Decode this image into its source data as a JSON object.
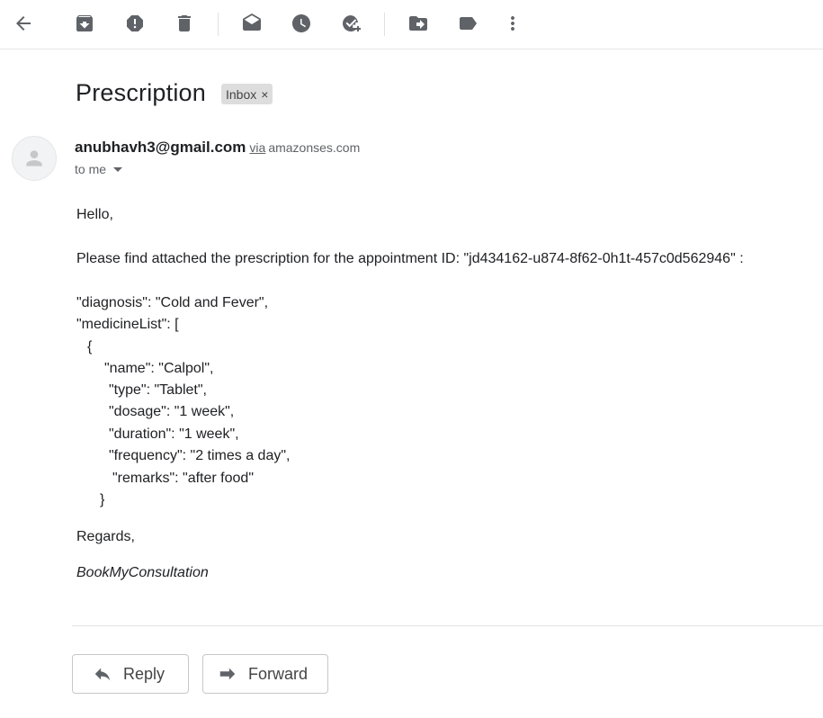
{
  "toolbar": {
    "icons": [
      "back-arrow-icon",
      "archive-icon",
      "report-spam-icon",
      "delete-icon",
      "mark-unread-icon",
      "snooze-icon",
      "add-to-tasks-icon",
      "move-to-icon",
      "label-icon",
      "more-vert-icon"
    ],
    "icon_color": "#5f6368"
  },
  "email": {
    "subject": "Prescription",
    "label": "Inbox",
    "label_remove": "×",
    "sender_name": "anubhavh3@gmail.com",
    "via": "via",
    "sender_domain": "amazonses.com",
    "recipient": "to me"
  },
  "body": {
    "greeting": "Hello,",
    "intro": "Please find attached the prescription for the appointment ID: \"jd434162-u874-8f62-0h1t-457c0d562946\" :",
    "diagnosis": "\"diagnosis\": \"Cold and Fever\",",
    "medicine_list_open": "\"medicineList\": [",
    "brace_open": "{",
    "name": "\"name\": \"Calpol\",",
    "type": "\"type\": \"Tablet\",",
    "dosage": "\"dosage\": \"1 week\",",
    "duration": "\"duration\": \"1 week\",",
    "frequency": "\"frequency\": \"2 times a day\",",
    "remarks": "\"remarks\": \"after food\"",
    "brace_close": "}",
    "regards": "Regards,",
    "signature": "BookMyConsultation"
  },
  "actions": {
    "reply_label": "Reply",
    "forward_label": "Forward"
  }
}
